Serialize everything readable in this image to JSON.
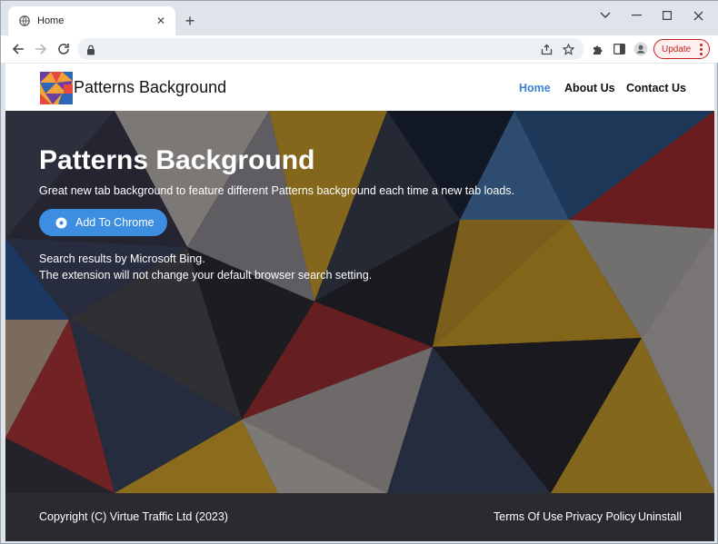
{
  "browser": {
    "tab_title": "Home",
    "tab_close": "✕",
    "new_tab": "+",
    "update_label": "Update",
    "address": ""
  },
  "site": {
    "brand": "Patterns Background",
    "nav": [
      {
        "label": "Home",
        "active": true
      },
      {
        "label": "About Us",
        "active": false
      },
      {
        "label": "Contact Us",
        "active": false
      }
    ]
  },
  "hero": {
    "title": "Patterns Background",
    "subtitle": "Great new tab background to feature different Patterns background each time a new tab loads.",
    "cta_label": "Add To Chrome",
    "note_line1": "Search results by Microsoft Bing.",
    "note_line2": "The extension will not change your default browser search setting."
  },
  "footer": {
    "copyright": "Copyright (C) Virtue Traffic Ltd (2023)",
    "links": [
      "Terms Of Use",
      "Privacy Policy",
      "Uninstall"
    ]
  },
  "colors": {
    "accent": "#3b82d1",
    "cta": "#3d8ee0",
    "update": "#c5221f",
    "footer_bg": "#2b2b2f"
  },
  "icons": [
    "globe-icon",
    "close-icon",
    "minimize-icon",
    "maximize-icon",
    "back-icon",
    "forward-icon",
    "reload-icon",
    "lock-icon",
    "share-icon",
    "star-icon",
    "puzzle-icon",
    "sidepanel-icon",
    "profile-icon",
    "kebab-menu-icon",
    "chrome-logo-icon",
    "chevron-down-icon"
  ]
}
